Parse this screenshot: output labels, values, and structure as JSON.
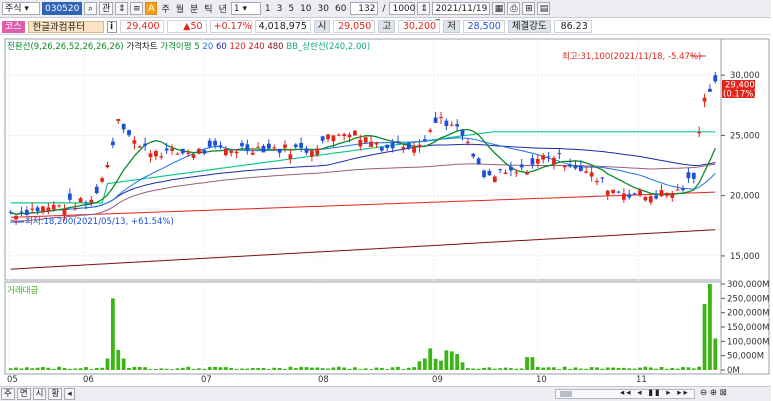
{
  "toolbar": {
    "type_select": "주식",
    "code": "030520",
    "btn_gwan": "관",
    "btn_auto": "A",
    "periods": [
      "주",
      "월",
      "분",
      "틱",
      "년"
    ],
    "unit_select": "1",
    "quick_values": [
      "1",
      "3",
      "5",
      "10",
      "30",
      "60"
    ],
    "count": "132",
    "slash": "/",
    "total": "1000",
    "date": "2021/11/19"
  },
  "infobar": {
    "tag": "코스",
    "name": "한글과컴퓨터",
    "info_icon": "i",
    "price": "29,400",
    "change": "▲50",
    "rate": "+0.17%",
    "volume": "4,018,975",
    "open_label": "시",
    "open": "29,050",
    "high_label": "고",
    "high": "30,200",
    "low_label": "저",
    "low": "28,500",
    "strength_label": "체결강도",
    "strength": "86.23"
  },
  "legend": {
    "ichimoku": "전환선(9,26,26,52,26,26,26)",
    "price_chart": "가격차트",
    "ma_label": "가격이평",
    "ma_items": [
      {
        "label": "5",
        "color": "#0a8a2a"
      },
      {
        "label": "20",
        "color": "#1a73e8"
      },
      {
        "label": "60",
        "color": "#1e2aa8"
      },
      {
        "label": "120",
        "color": "#e0251b"
      },
      {
        "label": "240",
        "color": "#c21a1a"
      },
      {
        "label": "480",
        "color": "#7a1010"
      }
    ],
    "bb": "BB_상한선(240,2.00)",
    "volume_title": "거래대금"
  },
  "annotations": {
    "max_label": "최고:31,100(2021/11/18, -5.47%)",
    "min_label": "최저:18,200(2021/05/13, +61.54%)",
    "last_price": "29,400",
    "last_rate": "(0.17%)"
  },
  "price_axis": [
    "30,000",
    "25,000",
    "20,000",
    "15,000"
  ],
  "volume_axis": [
    "300,000M",
    "250,000M",
    "200,000M",
    "150,000M",
    "100,000M",
    "50,000M",
    "0M"
  ],
  "month_labels": [
    "05",
    "06",
    "07",
    "08",
    "09",
    "10",
    "11"
  ],
  "bottom": {
    "btn_week": "주",
    "btn_month": "면",
    "btn_time": "시",
    "btn_range": "황"
  },
  "colors": {
    "up": "#e0251b",
    "down": "#1d4fd8",
    "volume": "#3bb514",
    "bb_upper": "#15c98b",
    "ichimoku": "#0a8a2a"
  }
}
